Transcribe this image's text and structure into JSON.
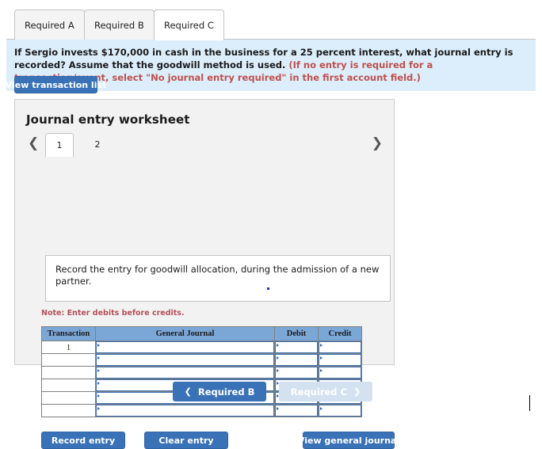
{
  "tabs": [
    {
      "label": "Required A",
      "active": false
    },
    {
      "label": "Required B",
      "active": false
    },
    {
      "label": "Required C",
      "active": true
    }
  ],
  "instruction": {
    "main": "If Sergio invests $170,000 in cash in the business for a 25 percent interest, what journal entry is recorded? Assume that the goodwill method is used.",
    "parenthetical": "(If no entry is required for a transaction/event, select \"No journal entry required\" in the first account field.)"
  },
  "toolbar": {
    "view_transaction_list": "View transaction list"
  },
  "worksheet": {
    "title": "Journal entry worksheet",
    "pager": {
      "prev_icon": "chevron-left-icon",
      "next_icon": "chevron-right-icon",
      "pages": [
        {
          "label": "1",
          "active": true
        },
        {
          "label": "2",
          "active": false
        }
      ]
    },
    "description": "Record the entry for goodwill allocation, during the admission of a new partner.",
    "note": "Note: Enter debits before credits.",
    "table": {
      "headers": [
        "Transaction",
        "General Journal",
        "Debit",
        "Credit"
      ],
      "rows": [
        {
          "transaction": "1",
          "general_journal": "",
          "debit": "",
          "credit": ""
        },
        {
          "transaction": "",
          "general_journal": "",
          "debit": "",
          "credit": ""
        },
        {
          "transaction": "",
          "general_journal": "",
          "debit": "",
          "credit": ""
        },
        {
          "transaction": "",
          "general_journal": "",
          "debit": "",
          "credit": ""
        },
        {
          "transaction": "",
          "general_journal": "",
          "debit": "",
          "credit": ""
        },
        {
          "transaction": "",
          "general_journal": "",
          "debit": "",
          "credit": ""
        }
      ]
    },
    "actions": {
      "record_entry": "Record entry",
      "clear_entry": "Clear entry",
      "view_general_journal": "View general journal"
    }
  },
  "footer_nav": {
    "prev": {
      "label": "Required B",
      "arrow": "❮",
      "enabled": true
    },
    "next": {
      "label": "Required C",
      "arrow": "❯",
      "enabled": false
    }
  },
  "colors": {
    "accent_blue": "#3a72b8",
    "banner_blue": "#dceefb",
    "table_header_blue": "#7ba7d7",
    "note_red": "#b5505a",
    "instruction_red": "#c0504d",
    "disabled_blue": "#d4e1f1"
  }
}
